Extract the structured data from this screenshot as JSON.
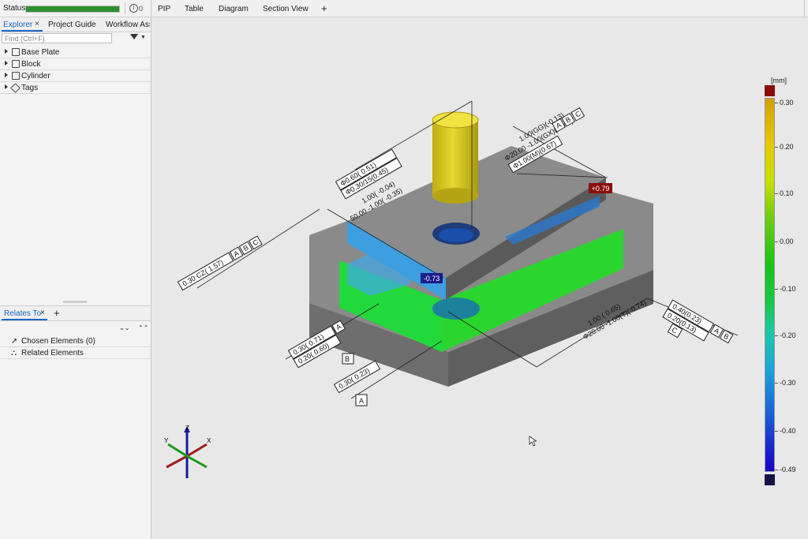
{
  "status": {
    "label": "Status",
    "progress": 1.0,
    "info_count": "0"
  },
  "explorer": {
    "tabs": [
      "Explorer",
      "Project Guide",
      "Workflow Ass"
    ],
    "close_glyph": "×",
    "find_placeholder": "Find (Ctrl+F)",
    "tree": [
      {
        "label": "Base Plate",
        "icon": "element-icon"
      },
      {
        "label": "Block",
        "icon": "element-icon"
      },
      {
        "label": "Cylinder",
        "icon": "element-icon"
      },
      {
        "label": "Tags",
        "icon": "tag-icon"
      }
    ]
  },
  "relates": {
    "tab": "Relates To",
    "close_glyph": "×",
    "add_glyph": "+",
    "expand_glyph": "⌄⌄",
    "collapse_glyph": "⌃⌃",
    "rows": [
      {
        "label": "Chosen Elements (0)",
        "icon": "cursor-icon"
      },
      {
        "label": "Related Elements",
        "icon": "hierarchy-icon"
      }
    ]
  },
  "view_tabs": [
    "PIP",
    "Table",
    "Diagram",
    "Section View"
  ],
  "view_tab_add": "+",
  "scale": {
    "unit": "[mm]",
    "top_color": "#8b0a0a",
    "bottom_color": "#14144a",
    "ticks": [
      "0.30",
      "0.20",
      "0.10",
      "0.00",
      "-0.10",
      "-0.20",
      "-0.30",
      "-0.40",
      "-0.49"
    ]
  },
  "labels": {
    "dev_red": "+0.79",
    "dev_blue": "-0.73",
    "cyl_top": "Φ0.60( 0.51)",
    "cyl_bot": "Φ0.30/15(0.45)",
    "hole_a": "1.00(GG)(-0.13)",
    "hole_b": "Φ20.00 -1.00(GX)(-0.47)",
    "hole_c": "Φ1.00(M)(0.67)",
    "hole_ref1": "A",
    "hole_ref2": "B",
    "hole_ref3": "C",
    "left_dim1": "1.00( -0.04)",
    "left_dim2": "50.00 -1.00( -0.35)",
    "left_fcf": "0.30 CZ( 1.57)",
    "left_ref1": "A",
    "left_ref2": "B",
    "left_ref3": "C",
    "perp1": "0.30( 0.71)",
    "perp2": "0.20( 0.60)",
    "perp_ref": "A",
    "perp_ref2": "B",
    "flat": "0.30( 0.23)",
    "flat_ref": "A",
    "right_dim1": "1.00    ( 0.65)",
    "right_dim2": "Φ20.00 -1.00(T)(-0.74)",
    "right_fcf1": "0.40(0.23)",
    "right_fcf2": "0.20(0.13)",
    "right_ref1": "A",
    "right_ref2": "B",
    "right_ref3": "C",
    "axis_x": "X",
    "axis_y": "Y",
    "axis_z": "Z"
  }
}
